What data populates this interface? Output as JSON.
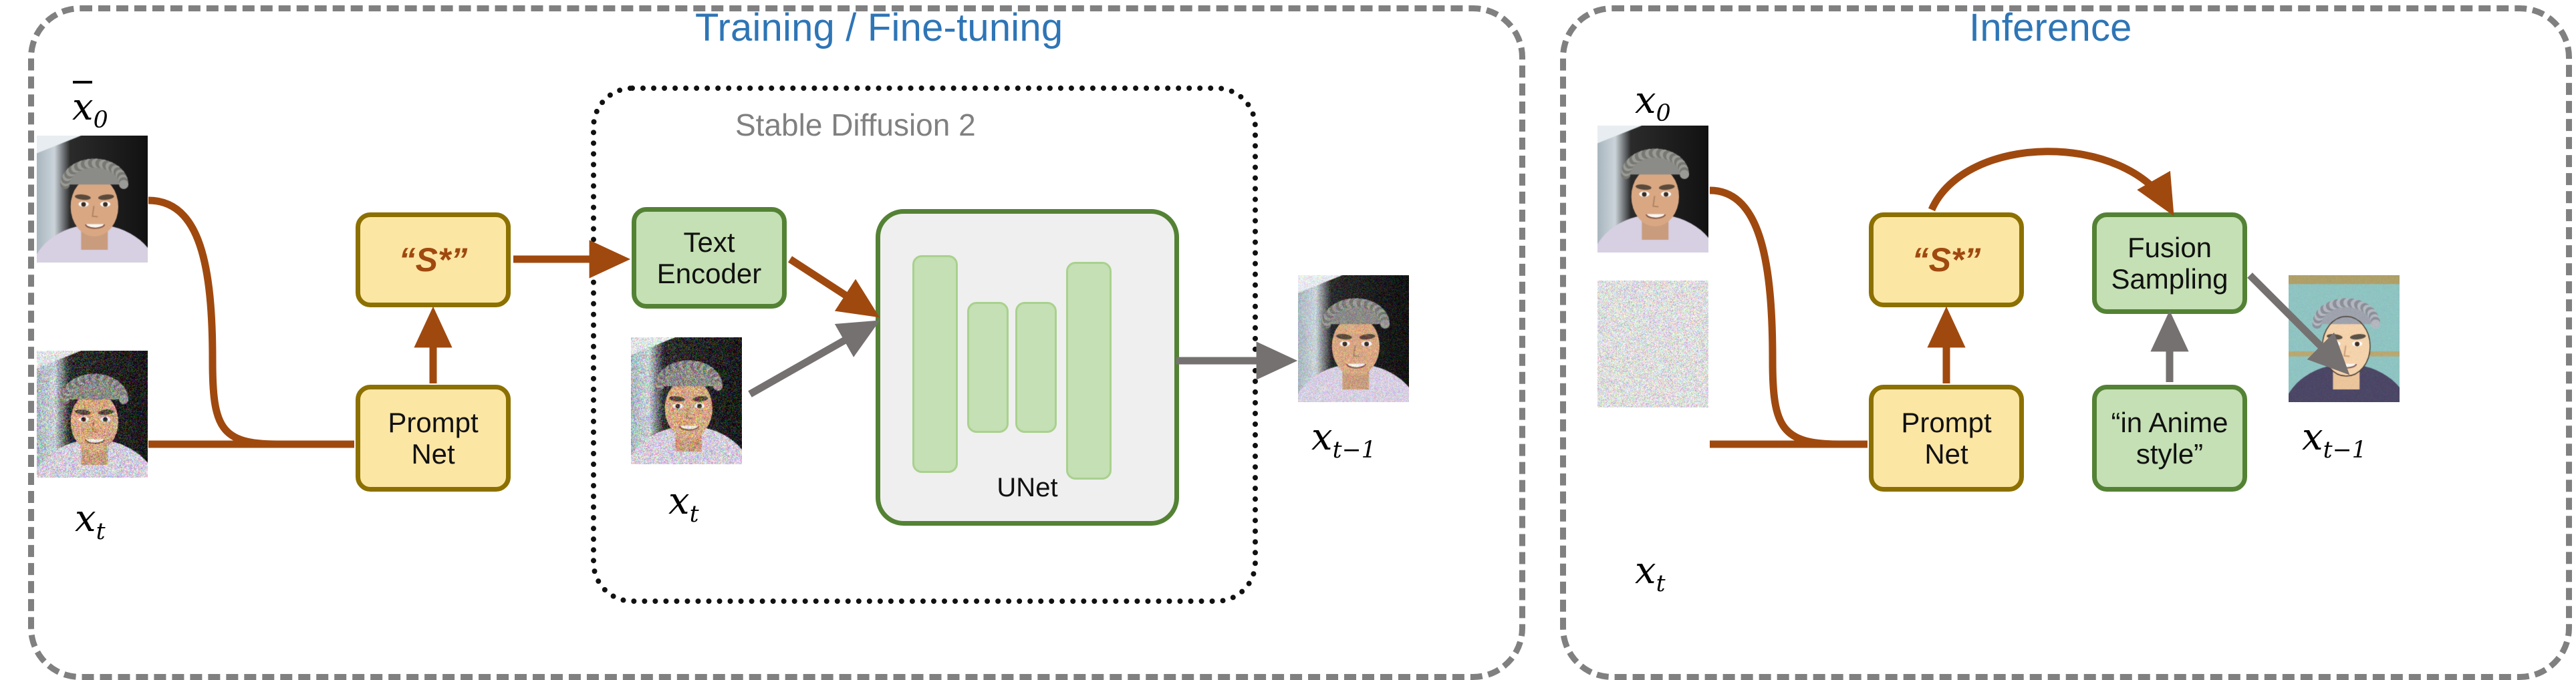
{
  "figure": {
    "kind": "method-diagram",
    "panels": [
      {
        "id": "training",
        "title": "Training / Fine-tuning",
        "title_color": "#2E75B6",
        "inner_group": {
          "title": "Stable Diffusion 2",
          "title_color": "#808080"
        },
        "images": [
          {
            "name": "clean-reference-image",
            "label": "x̅0",
            "label_parts": {
              "base": "x",
              "sub": "0",
              "overline": true
            }
          },
          {
            "name": "noisy-input-image",
            "label": "xt",
            "label_parts": {
              "base": "x",
              "sub": "t",
              "overline": false
            }
          },
          {
            "name": "noisy-latent-image",
            "label": "xt",
            "label_parts": {
              "base": "x",
              "sub": "t",
              "overline": false
            }
          },
          {
            "name": "denoised-output-image",
            "label": "xt-1",
            "label_parts": {
              "base": "x",
              "sub": "t−1",
              "overline": false
            }
          }
        ],
        "nodes": [
          {
            "id": "s-star",
            "label": "“S*”",
            "style": "yellow"
          },
          {
            "id": "prompt-net",
            "label": "Prompt\nNet",
            "style": "yellow"
          },
          {
            "id": "text-encoder",
            "label": "Text\nEncoder",
            "style": "green"
          },
          {
            "id": "unet",
            "label": "UNet",
            "style": "green"
          }
        ]
      },
      {
        "id": "inference",
        "title": "Inference",
        "title_color": "#2E75B6",
        "images": [
          {
            "name": "clean-input-image",
            "label": "x0",
            "label_parts": {
              "base": "x",
              "sub": "0",
              "overline": false
            }
          },
          {
            "name": "pure-noise-image",
            "label": "xt",
            "label_parts": {
              "base": "x",
              "sub": "t",
              "overline": false
            }
          },
          {
            "name": "anime-output-image",
            "label": "xt-1",
            "label_parts": {
              "base": "x",
              "sub": "t−1",
              "overline": false
            }
          }
        ],
        "nodes": [
          {
            "id": "s-star",
            "label": "“S*”",
            "style": "yellow"
          },
          {
            "id": "prompt-net",
            "label": "Prompt\nNet",
            "style": "yellow"
          },
          {
            "id": "fusion-sampling",
            "label": "Fusion\nSampling",
            "style": "green"
          },
          {
            "id": "style-prompt",
            "label": "“in Anime\nstyle”",
            "style": "green"
          }
        ]
      }
    ],
    "colors": {
      "panel_border": "#808080",
      "title_blue": "#2E75B6",
      "group_title_gray": "#808080",
      "yellow_fill": "#FCE6A4",
      "yellow_border": "#8C7000",
      "green_fill": "#C5E0B4",
      "green_border": "#548235",
      "unet_fill": "#EFEFEF",
      "brown_arrow": "#A0490F",
      "gray_arrow": "#767171",
      "star_text": "#A0490F"
    },
    "node_text": {
      "s_star": "“S*”",
      "prompt_line1": "Prompt",
      "prompt_line2": "Net",
      "text_enc_line1": "Text",
      "text_enc_line2": "Encoder",
      "unet": "UNet",
      "fusion_line1": "Fusion",
      "fusion_line2": "Sampling",
      "style_line1": "“in Anime",
      "style_line2": "style”"
    }
  }
}
